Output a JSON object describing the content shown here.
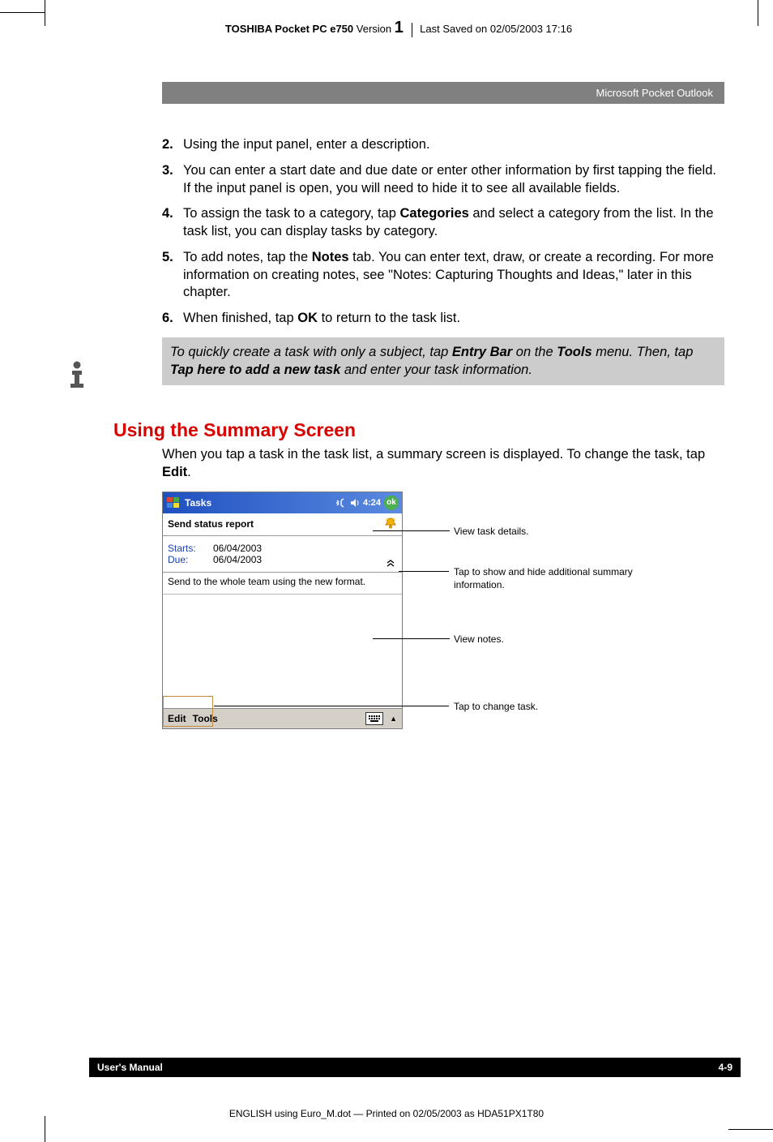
{
  "header": {
    "product": "TOSHIBA Pocket PC e750",
    "version_label": "Version",
    "version_num": "1",
    "saved": "Last Saved on 02/05/2003 17:16"
  },
  "gray_band": "Microsoft Pocket Outlook",
  "steps": [
    {
      "n": "2.",
      "t": "Using the input panel, enter a description."
    },
    {
      "n": "3.",
      "t": "You can enter a start date and due date or enter other information by first tapping the field. If the input panel is open, you will need to hide it to see all available fields."
    },
    {
      "n": "4.",
      "t_pre": "To assign the task to a category, tap ",
      "b1": "Categories",
      "t_post": " and select a category from the list. In the task list, you can display tasks by category."
    },
    {
      "n": "5.",
      "t_pre": "To add notes, tap the ",
      "b1": "Notes",
      "t_post": " tab. You can enter text, draw, or create a recording. For more information on creating notes, see \"Notes: Capturing Thoughts and Ideas,\" later in this chapter."
    },
    {
      "n": "6.",
      "t_pre": "When finished, tap ",
      "b1": "OK",
      "t_post": " to return to the task list."
    }
  ],
  "tip": {
    "p1a": "To quickly create a task with only a subject, tap ",
    "b1": "Entry Bar",
    "p1b": " on the ",
    "b2": "Tools",
    "p1c": " menu. Then, tap ",
    "b3": "Tap here to add a new task",
    "p1d": " and enter your task information."
  },
  "section_title": "Using the Summary Screen",
  "section_para_a": "When you tap a task in the task list, a summary screen is displayed. To change the task, tap ",
  "section_para_b": "Edit",
  "section_para_c": ".",
  "pda": {
    "title": "Tasks",
    "time": "4:24",
    "ok": "ok",
    "subject": "Send status report",
    "starts_lbl": "Starts:",
    "due_lbl": "Due:",
    "starts_val": "06/04/2003",
    "due_val": "06/04/2003",
    "note": "Send to the whole team using the new format.",
    "edit": "Edit",
    "tools": "Tools"
  },
  "callouts": {
    "c1": "View task details.",
    "c2a": "Tap to show and hide additional summary",
    "c2b": "information.",
    "c3": "View notes.",
    "c4": "Tap to change task."
  },
  "footer": {
    "left": "User's Manual",
    "right": "4-9",
    "print": "ENGLISH using Euro_M.dot — Printed on 02/05/2003 as HDA51PX1T80"
  }
}
